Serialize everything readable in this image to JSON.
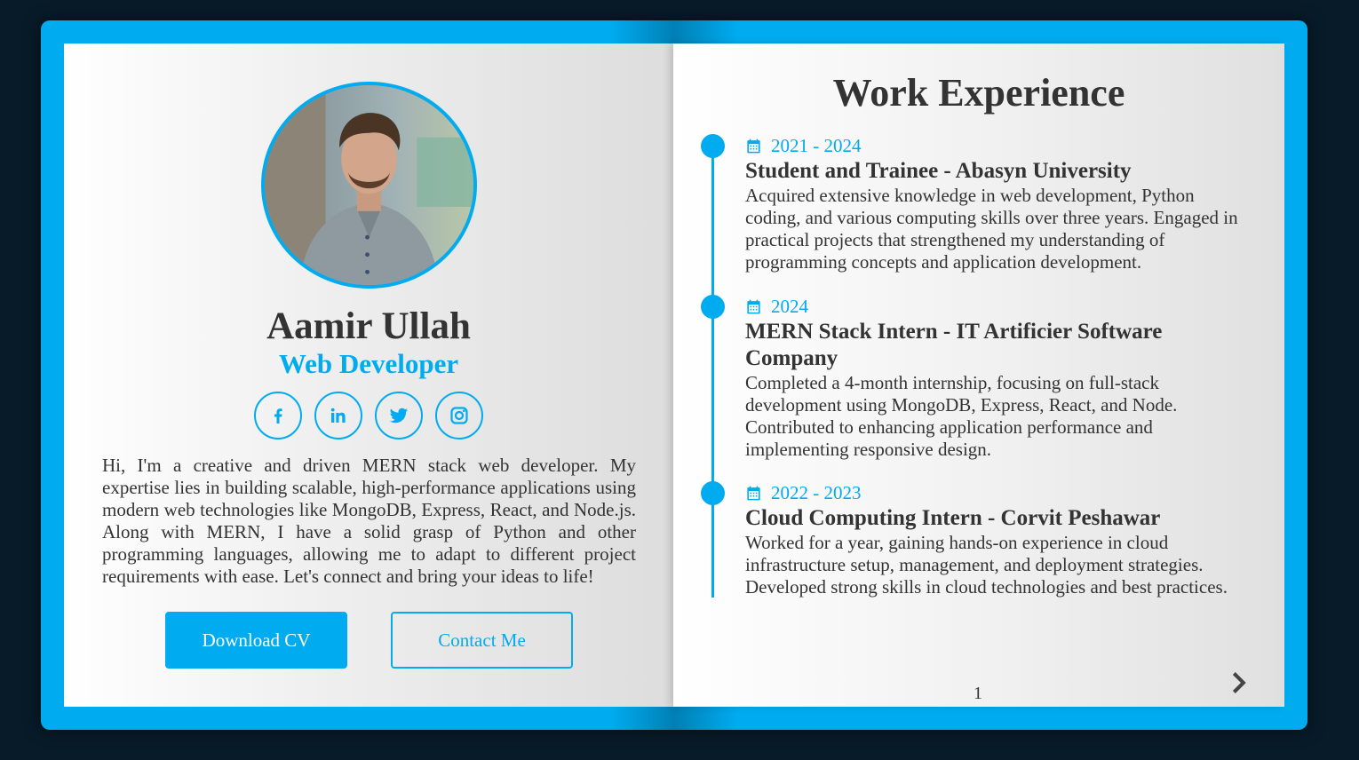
{
  "profile": {
    "name": "Aamir Ullah",
    "role": "Web Developer",
    "bio": "Hi, I'm a creative and driven MERN stack web developer. My expertise lies in building scalable, high-performance applications using modern web technologies like MongoDB, Express, React, and Node.js. Along with MERN, I have a solid grasp of Python and other programming languages, allowing me to adapt to different project requirements with ease. Let's connect and bring your ideas to life!",
    "socials": [
      {
        "icon": "facebook-icon"
      },
      {
        "icon": "linkedin-icon"
      },
      {
        "icon": "twitter-icon"
      },
      {
        "icon": "instagram-icon"
      }
    ],
    "buttons": {
      "download_cv": "Download CV",
      "contact_me": "Contact Me"
    }
  },
  "experience": {
    "title": "Work Experience",
    "items": [
      {
        "date": "2021 - 2024",
        "title": "Student and Trainee - Abasyn University",
        "description": "Acquired extensive knowledge in web development, Python coding, and various computing skills over three years. Engaged in practical projects that strengthened my understanding of programming concepts and application development."
      },
      {
        "date": "2024",
        "title": "MERN Stack Intern - IT Artificier Software Company",
        "description": "Completed a 4-month internship, focusing on full-stack development using MongoDB, Express, React, and Node. Contributed to enhancing application performance and implementing responsive design."
      },
      {
        "date": "2022 - 2023",
        "title": "Cloud Computing Intern - Corvit Peshawar",
        "description": "Worked for a year, gaining hands-on experience in cloud infrastructure setup, management, and deployment strategies. Developed strong skills in cloud technologies and best practices."
      }
    ],
    "page_number": "1"
  },
  "colors": {
    "accent": "#00abf0",
    "background": "#081b29",
    "text": "#333333"
  }
}
